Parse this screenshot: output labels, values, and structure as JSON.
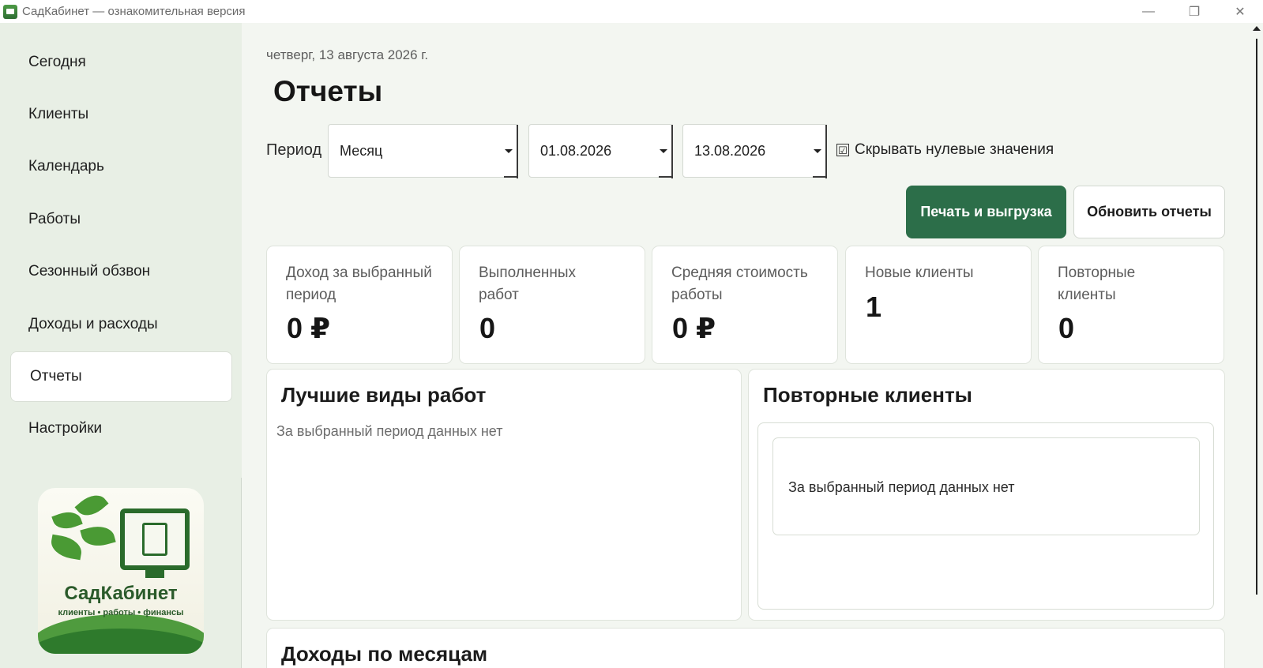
{
  "window": {
    "title": "СадКабинет — ознакомительная версия",
    "minimize_glyph": "—",
    "maximize_glyph": "❐",
    "close_glyph": "✕"
  },
  "sidebar": {
    "items": [
      {
        "label": "Сегодня",
        "active": false
      },
      {
        "label": "Клиенты",
        "active": false
      },
      {
        "label": "Календарь",
        "active": false
      },
      {
        "label": "Работы",
        "active": false
      },
      {
        "label": "Сезонный обзвон",
        "active": false
      },
      {
        "label": "Доходы и расходы",
        "active": false
      },
      {
        "label": "Отчеты",
        "active": true
      },
      {
        "label": "Настройки",
        "active": false
      }
    ],
    "logo": {
      "title": "СадКабинет",
      "subtitle": "клиенты • работы • финансы"
    }
  },
  "header": {
    "date": "четверг, 13 августа 2026 г.",
    "title": "Отчеты"
  },
  "filters": {
    "period_label": "Период",
    "period_value": "Месяц",
    "date_from": "01.08.2026",
    "date_to": "13.08.2026",
    "hide_zero_label": "Скрывать нулевые значения",
    "hide_zero_checked": "☑"
  },
  "actions": {
    "print_label": "Печать и выгрузка",
    "refresh_label": "Обновить отчеты"
  },
  "kpis": [
    {
      "label": "Доход за выбранный период",
      "value": "0 ₽"
    },
    {
      "label": "Выполненных работ",
      "value": "0"
    },
    {
      "label": "Средняя стоимость работы",
      "value": "0 ₽"
    },
    {
      "label": "Новые клиенты",
      "value": "1"
    },
    {
      "label": "Повторные клиенты",
      "value": "0"
    }
  ],
  "panels": {
    "best_works": {
      "title": "Лучшие виды работ",
      "empty": "За выбранный период данных нет"
    },
    "repeat_clients": {
      "title": "Повторные клиенты",
      "empty": "За выбранный период данных нет"
    },
    "income_by_month": {
      "title": "Доходы по месяцам"
    }
  },
  "colors": {
    "accent": "#2c6e49",
    "sidebar_bg": "#e8efe5",
    "main_bg": "#f3f6f1"
  }
}
